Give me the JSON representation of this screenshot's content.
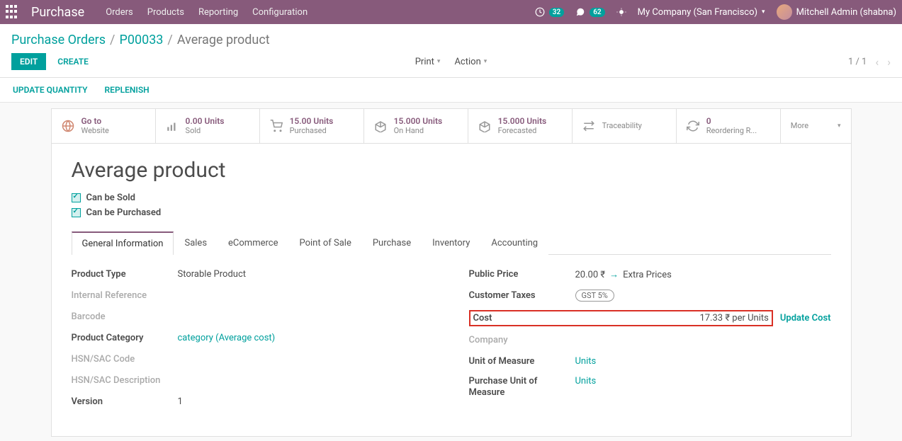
{
  "navbar": {
    "app_name": "Purchase",
    "menu": [
      "Orders",
      "Products",
      "Reporting",
      "Configuration"
    ],
    "activity_count": "32",
    "messages_count": "62",
    "company": "My Company (San Francisco)",
    "user": "Mitchell Admin (shabna)"
  },
  "breadcrumb": {
    "root": "Purchase Orders",
    "parent": "P00033",
    "current": "Average product"
  },
  "actions": {
    "edit": "EDIT",
    "create": "CREATE",
    "print": "Print",
    "action": "Action",
    "pager": "1 / 1"
  },
  "secondary": {
    "update_qty": "UPDATE QUANTITY",
    "replenish": "REPLENISH"
  },
  "stats": {
    "website": {
      "num": "Go to",
      "lbl": "Website"
    },
    "sold": {
      "num": "0.00 Units",
      "lbl": "Sold"
    },
    "purchased": {
      "num": "15.00 Units",
      "lbl": "Purchased"
    },
    "onhand": {
      "num": "15.000 Units",
      "lbl": "On Hand"
    },
    "forecasted": {
      "num": "15.000 Units",
      "lbl": "Forecasted"
    },
    "traceability": {
      "num": "",
      "lbl": "Traceability"
    },
    "reordering": {
      "num": "0",
      "lbl": "Reordering R..."
    },
    "more": {
      "lbl": "More"
    }
  },
  "product": {
    "title": "Average product",
    "can_be_sold": "Can be Sold",
    "can_be_purchased": "Can be Purchased"
  },
  "tabs": [
    "General Information",
    "Sales",
    "eCommerce",
    "Point of Sale",
    "Purchase",
    "Inventory",
    "Accounting"
  ],
  "fields_left": {
    "product_type": {
      "label": "Product Type",
      "value": "Storable Product"
    },
    "internal_ref": {
      "label": "Internal Reference",
      "value": ""
    },
    "barcode": {
      "label": "Barcode",
      "value": ""
    },
    "category": {
      "label": "Product Category",
      "value": "category (Average cost)"
    },
    "hsn": {
      "label": "HSN/SAC Code",
      "value": ""
    },
    "hsn_desc": {
      "label": "HSN/SAC Description",
      "value": ""
    },
    "version": {
      "label": "Version",
      "value": "1"
    }
  },
  "fields_right": {
    "public_price": {
      "label": "Public Price",
      "value": "20.00",
      "extra": "Extra Prices"
    },
    "customer_taxes": {
      "label": "Customer Taxes",
      "value": "GST 5%"
    },
    "cost": {
      "label": "Cost",
      "value": "17.33",
      "per": "per Units",
      "update": "Update Cost"
    },
    "company": {
      "label": "Company",
      "value": ""
    },
    "uom": {
      "label": "Unit of Measure",
      "value": "Units"
    },
    "purchase_uom": {
      "label": "Purchase Unit of Measure",
      "value": "Units"
    }
  }
}
